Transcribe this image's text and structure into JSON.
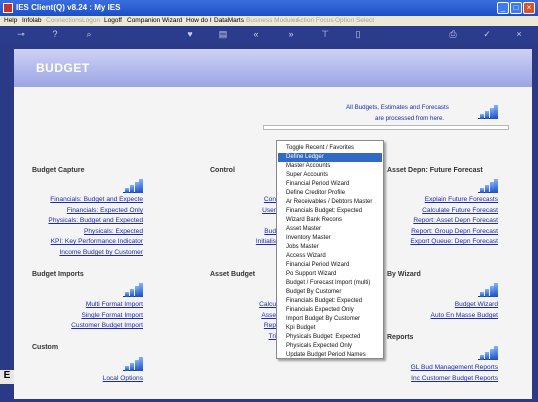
{
  "window": {
    "title": "IES Client(Q) v8.24 : My IES"
  },
  "menu": [
    {
      "label": "Help",
      "enabled": true
    },
    {
      "label": "Infolab",
      "enabled": true
    },
    {
      "label": "Connections",
      "enabled": false
    },
    {
      "label": "Logon",
      "enabled": false
    },
    {
      "label": "Logoff",
      "enabled": true
    },
    {
      "label": "Companion",
      "enabled": true
    },
    {
      "label": "Wizard",
      "enabled": true
    },
    {
      "label": "How do I",
      "enabled": true
    },
    {
      "label": "DataMarts",
      "enabled": true
    },
    {
      "label": "Business Modules",
      "enabled": false
    },
    {
      "label": "Action Focus",
      "enabled": false
    },
    {
      "label": "Option Select",
      "enabled": false
    }
  ],
  "page": {
    "title": "BUDGET",
    "intro_line1": "All Budgets, Estimates and Forecasts",
    "intro_line2": "are processed from here.",
    "left_edge": "E"
  },
  "sections": {
    "budget_capture": {
      "title": "Budget Capture",
      "links": [
        "Financials: Budget and Expecte",
        "Financials: Expected Only",
        "Physicals: Budget and Expected",
        "Physicals: Expected",
        "KPI: Key Performance Indicator",
        "Income Budget by Customer"
      ]
    },
    "control": {
      "title": "Control",
      "links": [
        "Con",
        "User",
        "Bud",
        "Initialis"
      ]
    },
    "asset_depn": {
      "title": "Asset Depn: Future Forecast",
      "links": [
        "Explain Future Forecasts",
        "Calculate Future Forecast",
        "Report: Asset Depn Forecast",
        "Report: Group Depn Forecast",
        "Export Queue: Depn Forecast"
      ]
    },
    "budget_imports": {
      "title": "Budget Imports",
      "links": [
        "Multi Format Import",
        "Single Format Import",
        "Customer Budget Import"
      ]
    },
    "asset_budget": {
      "title": "Asset Budget",
      "links": [
        "Calcu",
        "Asse",
        "Rep",
        "Tri"
      ]
    },
    "by_wizard": {
      "title": "By Wizard",
      "links": [
        "Budget Wizard",
        "Auto En Masse Budget"
      ]
    },
    "custom": {
      "title": "Custom",
      "links": [
        "Local Options"
      ]
    },
    "reports": {
      "title": "Reports",
      "links": [
        "GL Bud Management Reports",
        "Inc Customer Budget Reports"
      ]
    }
  },
  "dropdown": {
    "selected_index": 1,
    "items": [
      "Toggle Recent / Favorites",
      "Define Ledger",
      "Master Accounts",
      "Super Accounts",
      "Financial Period Wizard",
      "Define Creditor Profile",
      "Ar Receivables / Debtors Master",
      "Financials Budget: Expected",
      "Wizard Bank Recons",
      "Asset Master",
      "Inventory Master",
      "Jobs Master",
      "Access Wizard",
      "Financial Period Wizard",
      "Po Support Wizard",
      "Budget / Forecast Import (multi)",
      "Budget By Customer",
      "Financials Budget: Expected",
      "Financials Expected Only",
      "Import Budget By Customer",
      "Kpi Budget",
      "Physicals Budget: Expected",
      "Physicals Expected Only",
      "Update Budget Period Names"
    ]
  },
  "colors": {
    "title_bar": "#1c4fc4",
    "frame": "#2b3a86",
    "link": "#1a2ab0",
    "selection": "#316ac5"
  }
}
